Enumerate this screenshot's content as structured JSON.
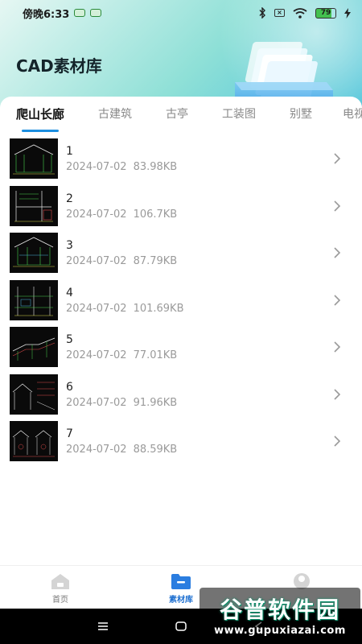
{
  "status_bar": {
    "time": "傍晚6:33",
    "battery": "79"
  },
  "header": {
    "title": "CAD素材库"
  },
  "tabs": [
    {
      "label": "爬山长廊",
      "active": true
    },
    {
      "label": "古建筑",
      "active": false
    },
    {
      "label": "古亭",
      "active": false
    },
    {
      "label": "工装图",
      "active": false
    },
    {
      "label": "别墅",
      "active": false
    },
    {
      "label": "电视",
      "active": false
    }
  ],
  "items": [
    {
      "title": "1",
      "date": "2024-07-02",
      "size": "83.98KB"
    },
    {
      "title": "2",
      "date": "2024-07-02",
      "size": "106.7KB"
    },
    {
      "title": "3",
      "date": "2024-07-02",
      "size": "87.79KB"
    },
    {
      "title": "4",
      "date": "2024-07-02",
      "size": "101.69KB"
    },
    {
      "title": "5",
      "date": "2024-07-02",
      "size": "77.01KB"
    },
    {
      "title": "6",
      "date": "2024-07-02",
      "size": "91.96KB"
    },
    {
      "title": "7",
      "date": "2024-07-02",
      "size": "88.59KB"
    }
  ],
  "bottom_nav": [
    {
      "label": "首页",
      "icon": "home-icon",
      "active": false
    },
    {
      "label": "素材库",
      "icon": "folder-icon",
      "active": true
    },
    {
      "label": "",
      "icon": "profile-icon",
      "active": false
    }
  ],
  "watermark": {
    "main": "谷普软件园",
    "sub": "www.gupuxiazai.com"
  },
  "colors": {
    "accent": "#1d8fe0",
    "header_gradient_start": "#e6f7f3",
    "header_gradient_end": "#4cc3d9",
    "nav_active": "#1d6fd0"
  }
}
